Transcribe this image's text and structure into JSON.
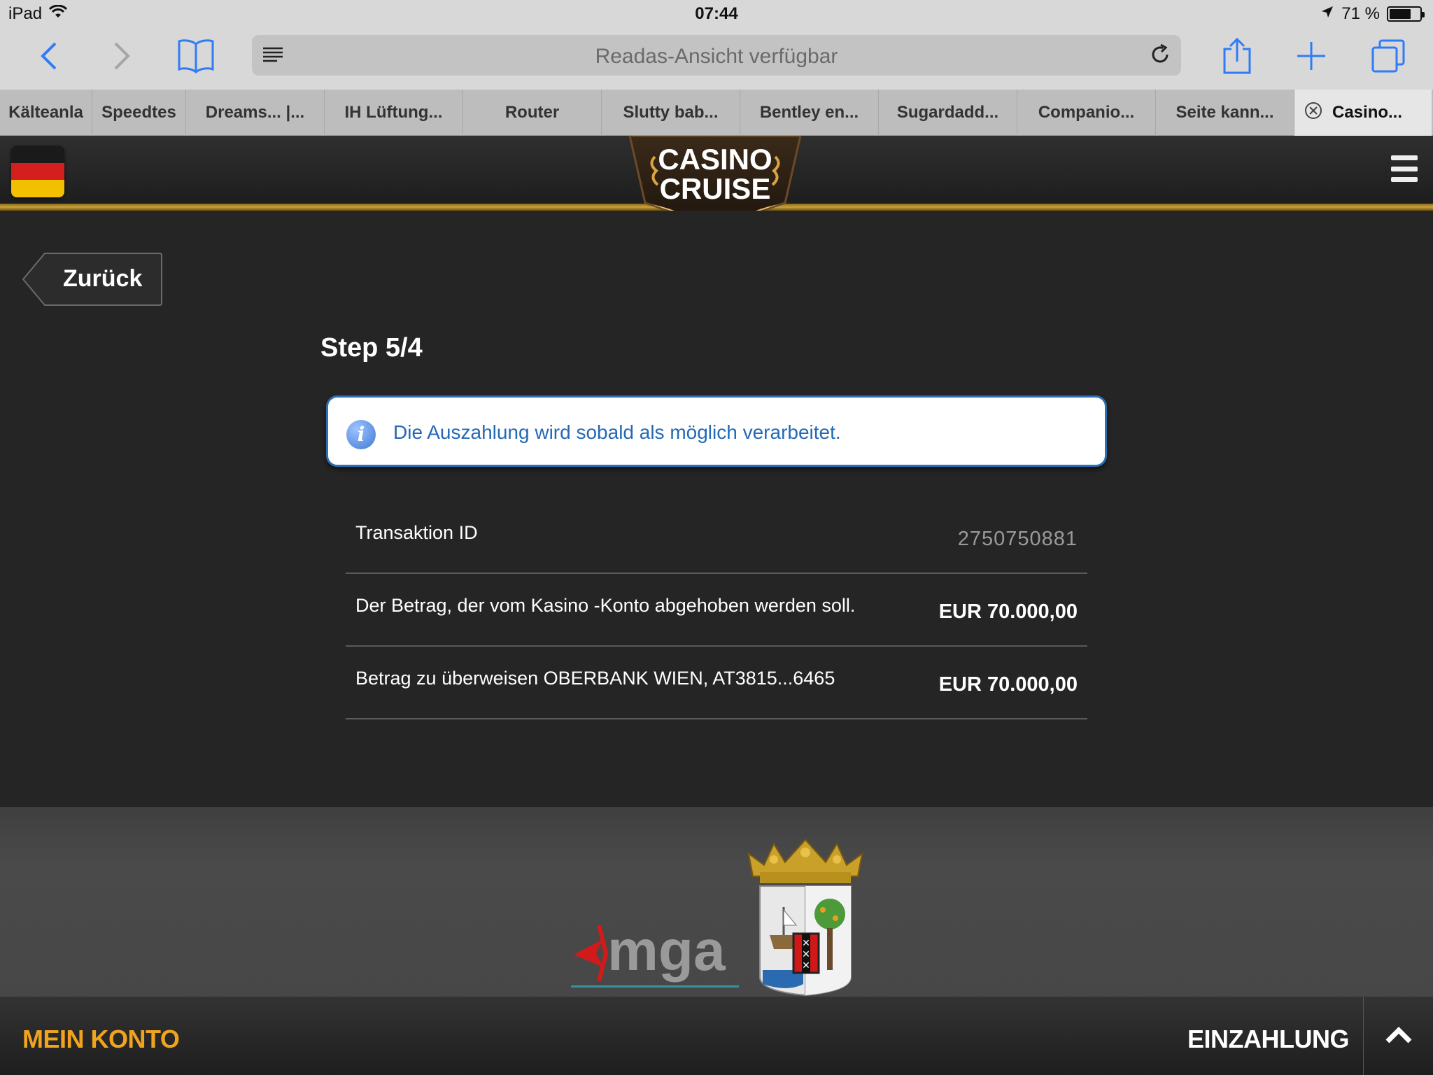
{
  "status_bar": {
    "device": "iPad",
    "time": "07:44",
    "battery_text": "71 %",
    "battery_level": 0.71
  },
  "browser": {
    "url_text": "Readas-Ansicht verfügbar",
    "tabs": [
      {
        "label": "Kälteanla"
      },
      {
        "label": "Speedtes"
      },
      {
        "label": "Dreams... |..."
      },
      {
        "label": "IH Lüftung..."
      },
      {
        "label": "Router"
      },
      {
        "label": "Slutty bab..."
      },
      {
        "label": "Bentley en..."
      },
      {
        "label": "Sugardadd..."
      },
      {
        "label": "Companio..."
      },
      {
        "label": "Seite kann..."
      },
      {
        "label": "Casino..."
      }
    ]
  },
  "site": {
    "logo_line1": "CASINO",
    "logo_line2": "CRUISE",
    "back_label": "Zurück",
    "step_title": "Step 5/4",
    "info_message": "Die Auszahlung wird sobald als möglich verarbeitet.",
    "details": [
      {
        "label": "Transaktion ID",
        "value": "2750750881"
      },
      {
        "label": "Der Betrag, der vom Kasino -Konto abgehoben werden soll.",
        "value": "EUR 70.000,00"
      },
      {
        "label": "Betrag zu überweisen OBERBANK WIEN, AT3815...6465",
        "value": "EUR 70.000,00"
      }
    ],
    "footer_logo_text": "mga",
    "my_account": "MEIN KONTO",
    "deposit": "EINZAHLUNG"
  },
  "colors": {
    "accent_gold": "#c9a23a",
    "info_blue": "#2468b6",
    "my_account_orange": "#f0a41e",
    "ios_blue": "#2f7cf6"
  }
}
